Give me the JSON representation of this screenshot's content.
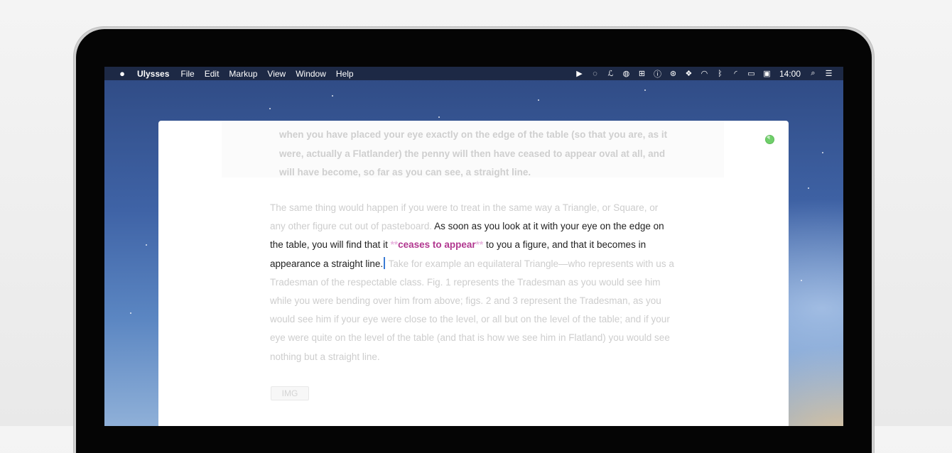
{
  "menubar": {
    "apple_icon": "apple-icon",
    "app_name": "Ulysses",
    "menus": [
      "File",
      "Edit",
      "Markup",
      "View",
      "Window",
      "Help"
    ],
    "status_icons": [
      "play-icon",
      "sync-icon",
      "script-icon",
      "activity-icon",
      "keyboard-icon",
      "info-icon",
      "aperture-icon",
      "dropbox-icon",
      "airdrop-icon",
      "bluetooth-icon",
      "wifi-icon",
      "battery-icon",
      "display-icon"
    ],
    "clock": "14:00",
    "spotlight_icon": "search-icon",
    "notification_icon": "list-icon"
  },
  "editor": {
    "quote": "when you have placed your eye exactly on the edge of the table (so that you are, as it were, actually a Flatlander) the penny will then have ceased to appear oval at all, and will have become, so far as you can see, a straight line.",
    "para_before": "The same thing would happen if you were to treat in the same way a Triangle, or Square, or any other figure cut out of pasteboard. ",
    "active_1": "As soon as you look at it with your eye on the edge on the table, you will find that it ",
    "markup_open": "**",
    "emphasis": "ceases to appear",
    "markup_close": "**",
    "active_2": " to you a figure, and that it becomes in appearance a straight line.",
    "para_after": " Take for example an equilateral Triangle—who represents with us a Tradesman of the respectable class. Fig. 1 represents the Tradesman as you would see him while you were bending over him from above; figs. 2 and 3 represent the Tradesman, as you would see him if your eye were close to the level, or all but on the level of the table; and if your eye were quite on the level of the table (and that is how we see him in Flatland) you would see nothing but a straight line.",
    "image_tag": "IMG"
  },
  "colors": {
    "emphasis": "#b1378f",
    "markup": "#e8b4de",
    "progress": "#6fcf6a",
    "cursor": "#3a7bd5"
  }
}
